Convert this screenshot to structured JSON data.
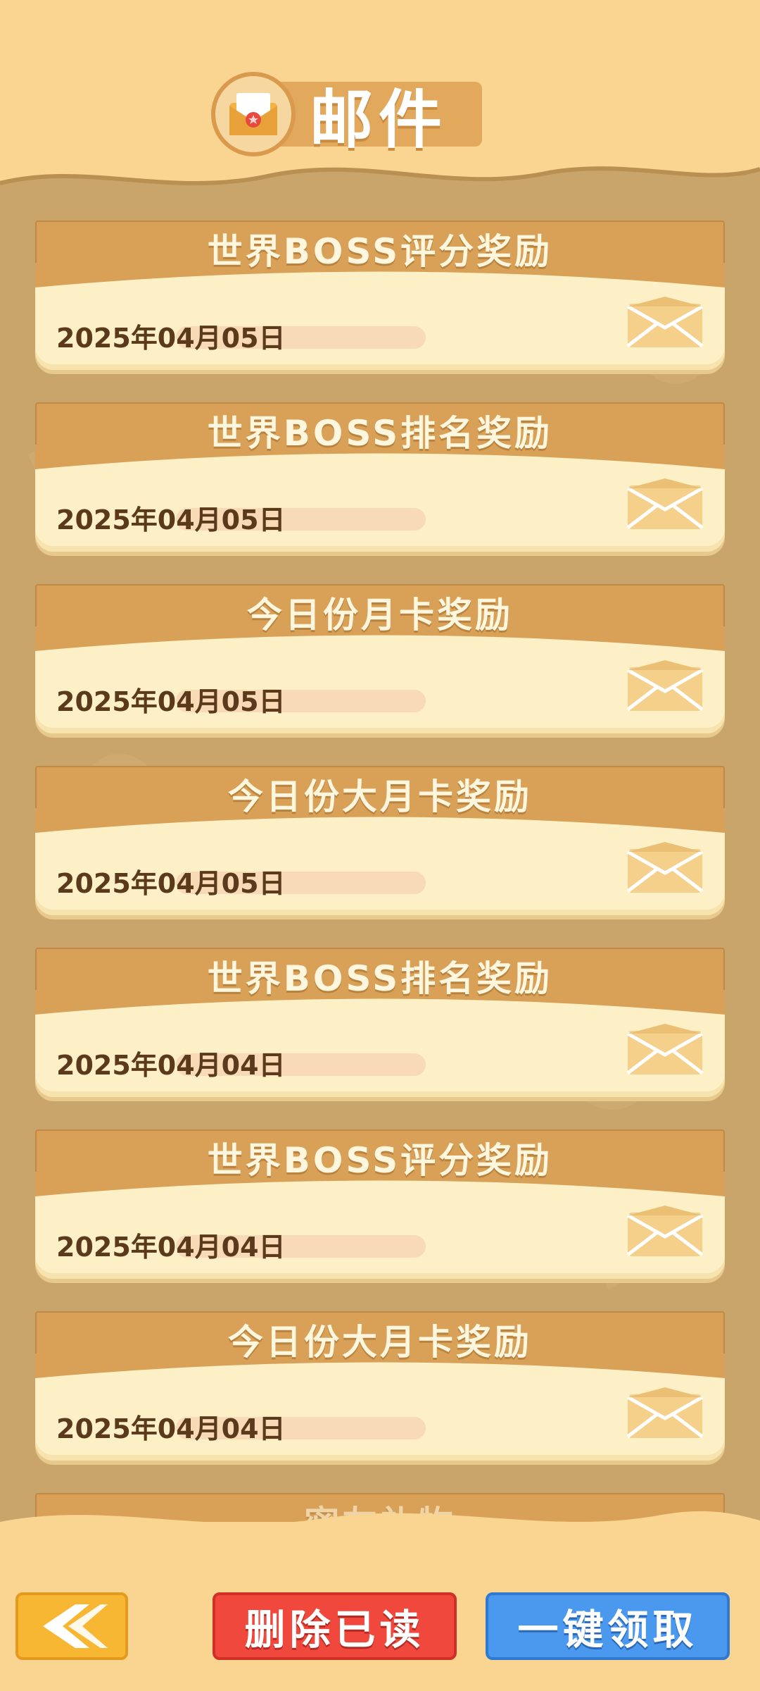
{
  "header": {
    "title": "邮件",
    "icon": "envelope-badge-icon"
  },
  "mails": [
    {
      "title": "世界BOSS评分奖励",
      "date": "2025年04月05日"
    },
    {
      "title": "世界BOSS排名奖励",
      "date": "2025年04月05日"
    },
    {
      "title": "今日份月卡奖励",
      "date": "2025年04月05日"
    },
    {
      "title": "今日份大月卡奖励",
      "date": "2025年04月05日"
    },
    {
      "title": "世界BOSS排名奖励",
      "date": "2025年04月04日"
    },
    {
      "title": "世界BOSS评分奖励",
      "date": "2025年04月04日"
    },
    {
      "title": "今日份大月卡奖励",
      "date": "2025年04月04日"
    },
    {
      "title": "密友礼物",
      "date": ""
    }
  ],
  "footer": {
    "back_icon": "chevron-left-icon",
    "delete_read_label": "删除已读",
    "claim_all_label": "一键领取"
  },
  "colors": {
    "header_bg": "#FAD592",
    "card_header": "#D9A157",
    "card_body": "#FDF0C6",
    "delete_button": "#F1483D",
    "claim_button": "#4A99EE",
    "back_button": "#F7B733"
  }
}
